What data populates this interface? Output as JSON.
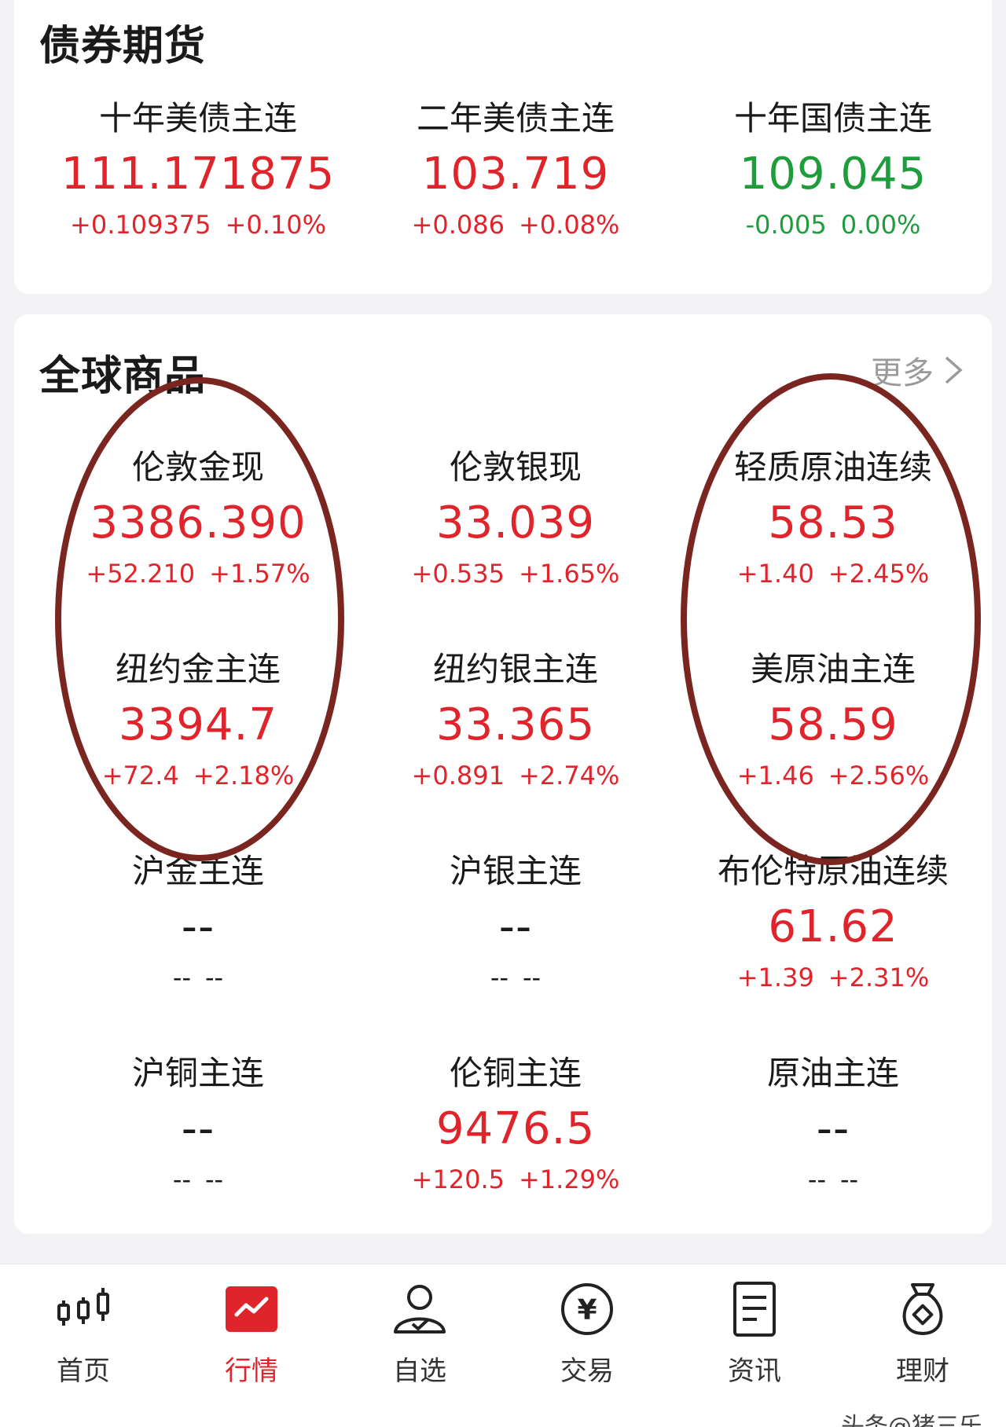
{
  "bond_section": {
    "title": "债券期货",
    "items": [
      {
        "name": "十年美债主连",
        "price": "111.171875",
        "change": "+0.109375",
        "pct": "+0.10%"
      },
      {
        "name": "二年美债主连",
        "price": "103.719",
        "change": "+0.086",
        "pct": "+0.08%"
      },
      {
        "name": "十年国债主连",
        "price": "109.045",
        "change": "-0.005",
        "pct": "0.00%"
      }
    ]
  },
  "commodity_section": {
    "title": "全球商品",
    "more_label": "更多",
    "items": [
      {
        "name": "伦敦金现",
        "price": "3386.390",
        "change": "+52.210",
        "pct": "+1.57%"
      },
      {
        "name": "伦敦银现",
        "price": "33.039",
        "change": "+0.535",
        "pct": "+1.65%"
      },
      {
        "name": "轻质原油连续",
        "price": "58.53",
        "change": "+1.40",
        "pct": "+2.45%"
      },
      {
        "name": "纽约金主连",
        "price": "3394.7",
        "change": "+72.4",
        "pct": "+2.18%"
      },
      {
        "name": "纽约银主连",
        "price": "33.365",
        "change": "+0.891",
        "pct": "+2.74%"
      },
      {
        "name": "美原油主连",
        "price": "58.59",
        "change": "+1.46",
        "pct": "+2.56%"
      },
      {
        "name": "沪金主连",
        "price": "--",
        "change": "--",
        "pct": "--"
      },
      {
        "name": "沪银主连",
        "price": "--",
        "change": "--",
        "pct": "--"
      },
      {
        "name": "布伦特原油连续",
        "price": "61.62",
        "change": "+1.39",
        "pct": "+2.31%"
      },
      {
        "name": "沪铜主连",
        "price": "--",
        "change": "--",
        "pct": "--"
      },
      {
        "name": "伦铜主连",
        "price": "9476.5",
        "change": "+120.5",
        "pct": "+1.29%"
      },
      {
        "name": "原油主连",
        "price": "--",
        "change": "--",
        "pct": "--"
      }
    ]
  },
  "colors": {
    "up": "#e0242b",
    "down": "#1f9c3b",
    "annotation": "#7a2520"
  },
  "tabbar": {
    "tabs": [
      {
        "label": "首页",
        "icon": "candlestick-icon"
      },
      {
        "label": "行情",
        "icon": "market-chart-icon"
      },
      {
        "label": "自选",
        "icon": "user-check-icon"
      },
      {
        "label": "交易",
        "icon": "yuan-coin-icon"
      },
      {
        "label": "资讯",
        "icon": "document-icon"
      },
      {
        "label": "理财",
        "icon": "money-bag-icon"
      }
    ],
    "active_tab": "行情"
  },
  "watermark": "头条@猪三乐"
}
